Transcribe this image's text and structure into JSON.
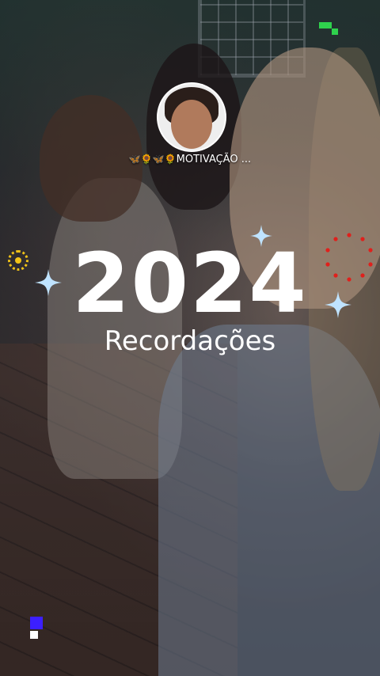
{
  "story": {
    "channel_name": "MOTIVAÇÃO ...",
    "channel_emojis": "🦋🌻🦋🌻",
    "title_year": "2024",
    "title_sub": "Recordações"
  },
  "icons": {
    "profile_avatar": "avatar",
    "sparkles": [
      "sparkle-icon",
      "sparkle-icon",
      "sparkle-icon"
    ],
    "sun": "sun-sticker-icon",
    "dots_circle": "dots-ring-icon"
  },
  "colors": {
    "sparkle": "#bfe3ff",
    "sun": "#f2c318",
    "dots": "#e0201c",
    "pixel_green": "#2fd14d",
    "pixel_blue": "#3c1fff"
  }
}
